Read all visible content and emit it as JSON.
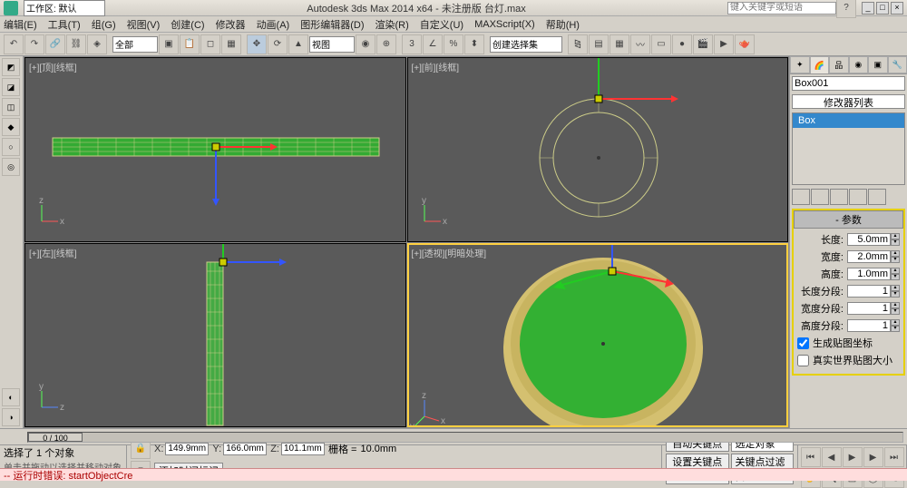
{
  "title": "Autodesk 3ds Max  2014 x64    - 未注册版    台灯.max",
  "search_placeholder": "键入关键字或短语",
  "menus": [
    "编辑(E)",
    "工具(T)",
    "组(G)",
    "视图(V)",
    "创建(C)",
    "修改器",
    "动画(A)",
    "图形编辑器(D)",
    "渲染(R)",
    "自定义(U)",
    "MAXScript(X)",
    "帮助(H)"
  ],
  "workspace_label": "工作区: 默认",
  "scope_label": "全部",
  "view_label": "视图",
  "selset_label": "创建选择集",
  "viewports": {
    "tl": "[+][顶][线框]",
    "tr": "[+][前][线框]",
    "bl": "[+][左][线框]",
    "br": "[+][透视][明暗处理]"
  },
  "cmd": {
    "obj_name": "Box001",
    "mod_list": "修改器列表",
    "stack_item": "Box"
  },
  "rollout": {
    "title": "参数",
    "length_l": "长度:",
    "length_v": "5.0mm",
    "width_l": "宽度:",
    "width_v": "2.0mm",
    "height_l": "高度:",
    "height_v": "1.0mm",
    "lseg_l": "长度分段:",
    "lseg_v": "1",
    "wseg_l": "宽度分段:",
    "wseg_v": "1",
    "hseg_l": "高度分段:",
    "hseg_v": "1",
    "gen_map": "生成贴图坐标",
    "real_map": "真实世界贴图大小"
  },
  "time": {
    "thumb": "0 / 100"
  },
  "status": {
    "sel": "选择了 1 个对象",
    "hint": "单击并拖动以选择并移动对象",
    "x_l": "X:",
    "x_v": "149.9mm",
    "y_l": "Y:",
    "y_v": "166.0mm",
    "z_l": "Z:",
    "z_v": "101.1mm",
    "grid_l": "栅格 =",
    "grid_v": "10.0mm",
    "autokey": "自动关键点",
    "selfilt": "选定对象",
    "setkey": "设置关键点",
    "addtag": "添加时间标记",
    "keyfilt": "关键点过滤器..."
  },
  "err": "-- 运行时错误: startObjectCre"
}
